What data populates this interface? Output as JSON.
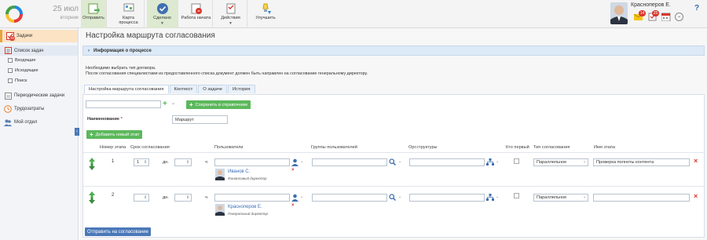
{
  "header": {
    "date_day": "25 июл",
    "date_weekday": "вторник",
    "toolbar": [
      {
        "label": "Отправить",
        "icon": "send-icon"
      },
      {
        "label": "Карта процесса",
        "icon": "process-map-icon"
      },
      {
        "label": "Сделано",
        "icon": "done-icon"
      },
      {
        "label": "Работа начата",
        "icon": "work-started-icon"
      },
      {
        "label": "Действия",
        "icon": "actions-icon"
      },
      {
        "label": "Улучшить",
        "icon": "improve-icon"
      }
    ],
    "user_name": "Красноперов Е.",
    "badges": {
      "mail": "14",
      "tasks": "25"
    },
    "help": "?"
  },
  "sidebar": {
    "badge": "25",
    "items": [
      {
        "label": "Задачи"
      },
      {
        "label": "Список задач"
      },
      {
        "label": "Входящие"
      },
      {
        "label": "Исходящие"
      },
      {
        "label": "Поиск"
      },
      {
        "label": "Периодические задачи"
      },
      {
        "label": "Трудозатраты"
      },
      {
        "label": "Мой отдел"
      }
    ]
  },
  "main": {
    "title": "Настройка маршрута согласования",
    "info_bar": "Информация о процессе",
    "note_line1": "Необходимо выбрать тип договора.",
    "note_line2": "После согласования специалистами из предоставленного списка документ должен быть направлен на согласование генеральному директору.",
    "tabs": [
      "Настройка маршрута согласования",
      "Контекст",
      "О задаче",
      "История"
    ],
    "save_to_ref": "Сохранить в справочнике",
    "name_label": "Наименование",
    "name_required": "*",
    "name_value": "Маршрут",
    "add_stage": "Добавить новый этап",
    "columns": {
      "stage_no": "Номер этапа",
      "term": "Срок согласования",
      "users": "Пользователи",
      "groups": "Группы пользователей",
      "org": "Орг.структуры",
      "who_first": "Кто первый",
      "type": "Тип согласования",
      "stage_name": "Имя этапа"
    },
    "stages": [
      {
        "no": "1",
        "days": "1",
        "days_unit": "дн.",
        "hours_unit": "ч",
        "user_name": "Иванов С.",
        "user_pos": "Финансовый директор",
        "type": "Параллельное",
        "stage_name": "Проверка полноты контента"
      },
      {
        "no": "2",
        "days": "",
        "days_unit": "дн.",
        "hours_unit": "ч",
        "user_name": "Красноперов Е.",
        "user_pos": "Генеральный директор",
        "type": "Параллельное",
        "stage_name": ""
      }
    ],
    "submit": "Отправить на согласование"
  },
  "colors": {
    "accent_green": "#5cb85c",
    "accent_blue": "#4a78b8",
    "bar_blue": "#dce9f7",
    "remove_red": "#d9362b"
  }
}
